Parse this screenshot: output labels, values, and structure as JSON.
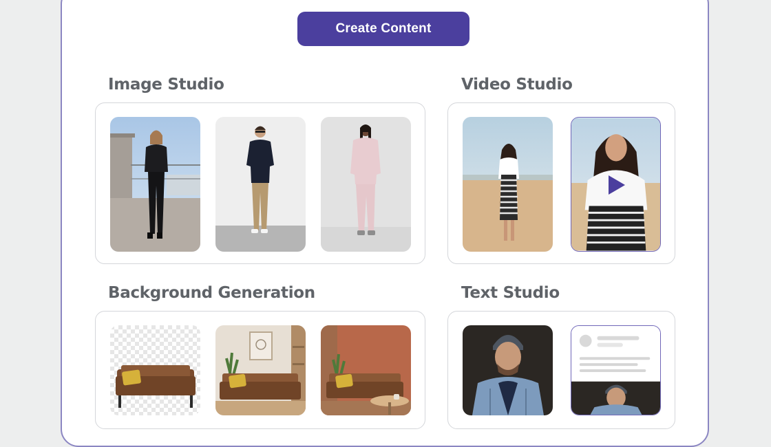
{
  "header": {
    "create_label": "Create Content"
  },
  "sections": {
    "image_studio": {
      "title": "Image Studio"
    },
    "video_studio": {
      "title": "Video Studio"
    },
    "background_generation": {
      "title": "Background Generation"
    },
    "text_studio": {
      "title": "Text Studio"
    }
  },
  "colors": {
    "accent": "#4b3f9e",
    "panel_border": "#8b86c2",
    "card_border": "#d4d6da",
    "title_text": "#5f6368",
    "page_bg": "#edeeee"
  },
  "icons": {
    "video_play": "play-icon"
  }
}
